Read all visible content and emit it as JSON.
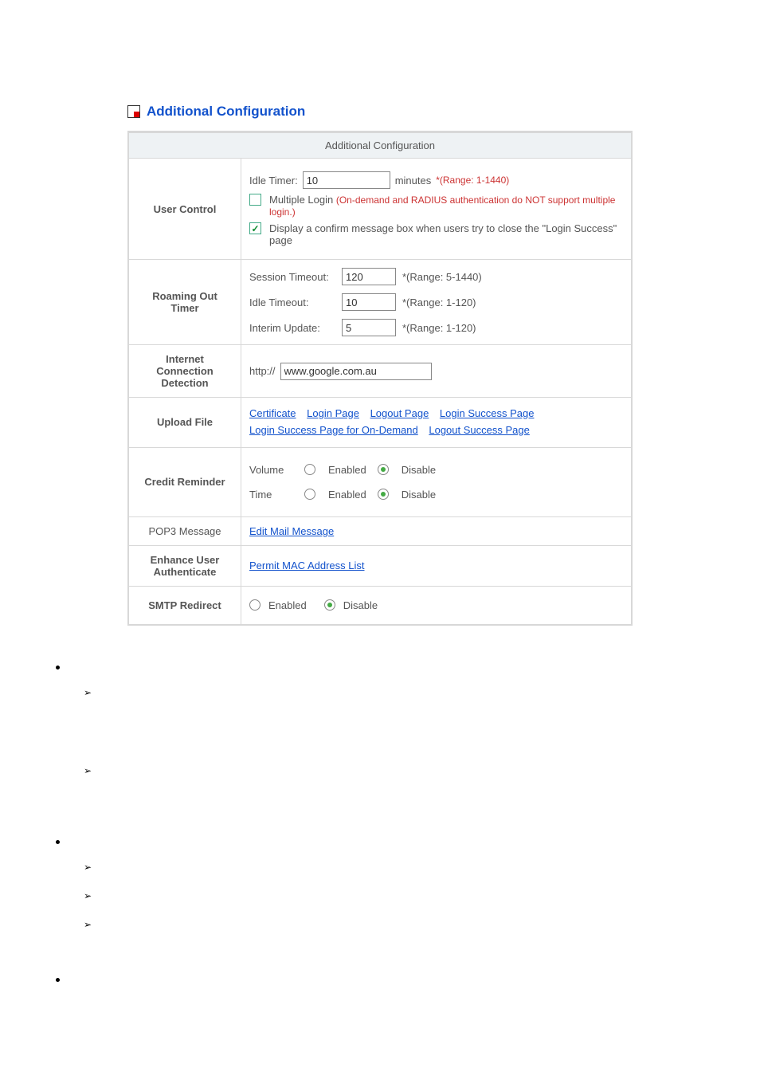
{
  "header": {
    "title": "Additional Configuration"
  },
  "table": {
    "caption": "Additional Configuration",
    "rows": {
      "user_control": {
        "label": "User Control",
        "idle_timer_label": "Idle Timer:",
        "idle_timer_value": "10",
        "idle_timer_unit": "minutes",
        "idle_timer_range": "*(Range: 1-1440)",
        "multiple_login_label": "Multiple Login",
        "multiple_login_note": "(On-demand and RADIUS authentication do NOT support multiple login.)",
        "confirm_box_label": "Display a confirm message box when users try to close the \"Login Success\" page"
      },
      "roaming": {
        "label": "Roaming Out Timer",
        "session_timeout_label": "Session Timeout:",
        "session_timeout_value": "120",
        "session_timeout_range": "*(Range: 5-1440)",
        "idle_timeout_label": "Idle Timeout:",
        "idle_timeout_value": "10",
        "idle_timeout_range": "*(Range: 1-120)",
        "interim_label": "Interim Update:",
        "interim_value": "5",
        "interim_range": "*(Range: 1-120)"
      },
      "internet": {
        "label": "Internet Connection Detection",
        "prefix": "http://",
        "url": "www.google.com.au"
      },
      "upload": {
        "label": "Upload File",
        "links": {
          "certificate": "Certificate",
          "login_page": "Login Page",
          "logout_page": "Logout Page",
          "login_success": "Login Success Page",
          "login_success_ondemand": "Login Success Page for On-Demand",
          "logout_success": "Logout Success Page"
        }
      },
      "credit": {
        "label": "Credit Reminder",
        "volume_label": "Volume",
        "time_label": "Time",
        "enabled": "Enabled",
        "disable": "Disable"
      },
      "pop3": {
        "label": "POP3 Message",
        "link": "Edit Mail Message"
      },
      "enhance": {
        "label": "Enhance User Authenticate",
        "link": "Permit MAC Address List"
      },
      "smtp": {
        "label": "SMTP Redirect",
        "enabled": "Enabled",
        "disable": "Disable"
      }
    }
  }
}
